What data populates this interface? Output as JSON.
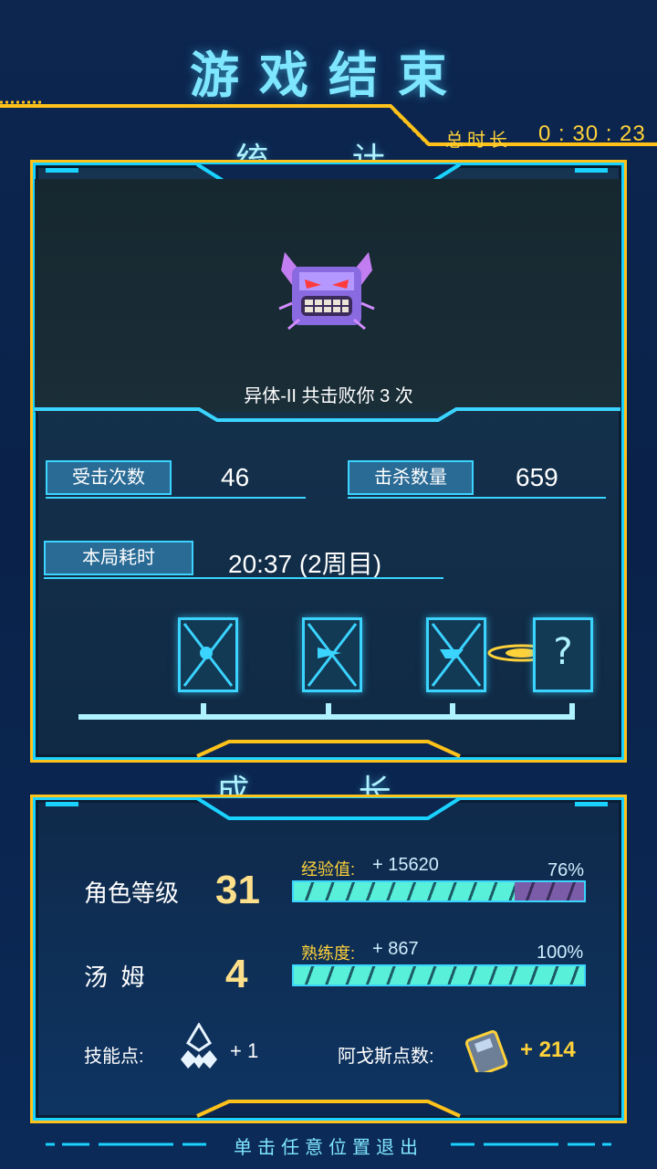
{
  "title": "游戏结束",
  "total_time": {
    "label": "总时长",
    "value": "0 : 30 : 23"
  },
  "stats": {
    "section_title": "统 计",
    "boss_caption": "异体-II 共击败你 3 次",
    "hits_label": "受击次数",
    "hits_value": "46",
    "kills_label": "击杀数量",
    "kills_value": "659",
    "time_label": "本局耗时",
    "time_value": "20:37 (2周目)"
  },
  "growth": {
    "section_title": "成 长",
    "level_label": "角色等级",
    "level_value": "31",
    "exp_label": "经验值:",
    "exp_gain": "+ 15620",
    "exp_percent_text": "76%",
    "exp_percent": 0.76,
    "char_label": "汤  姆",
    "char_value": "4",
    "prof_label": "熟练度:",
    "prof_gain": "+ 867",
    "prof_percent_text": "100%",
    "prof_percent": 1.0,
    "skill_label": "技能点:",
    "skill_value": "+ 1",
    "argos_label": "阿戈斯点数:",
    "argos_value": "+ 214"
  },
  "footer": "单击任意位置退出",
  "colors": {
    "accent": "#3ad4ff",
    "gold": "#ffc21a",
    "title": "#7fe6ff"
  }
}
